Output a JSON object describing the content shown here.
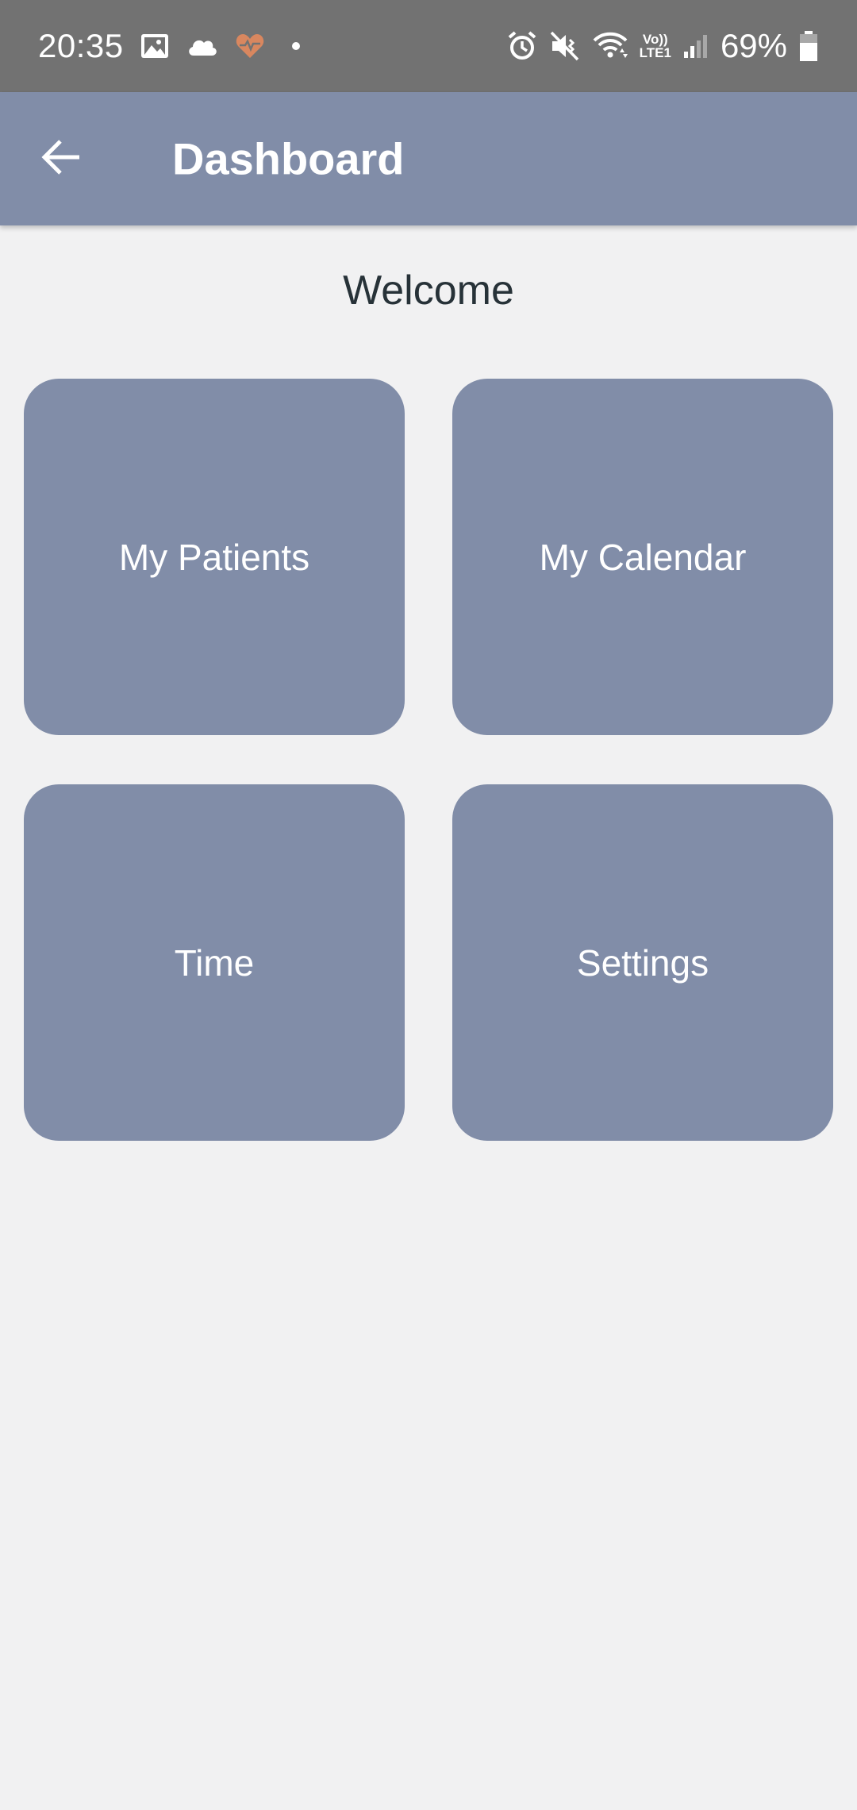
{
  "status_bar": {
    "time": "20:35",
    "battery_percent": "69%",
    "lte_top": "Vo))",
    "lte_bottom": "LTE1",
    "icons": [
      "gallery-icon",
      "cloud-icon",
      "health-heart-icon",
      "notification-dot-icon",
      "alarm-icon",
      "mute-icon",
      "wifi-icon",
      "volte-lte-icon",
      "signal-icon",
      "battery-icon"
    ],
    "colors": {
      "background": "#727272",
      "heart": "#d9875f"
    },
    "battery_level": 0.69
  },
  "app_bar": {
    "title": "Dashboard",
    "back_icon": "arrow-back-icon",
    "color": "#818da8"
  },
  "main": {
    "welcome": "Welcome",
    "tiles": [
      {
        "label": "My Patients"
      },
      {
        "label": "My Calendar"
      },
      {
        "label": "Time"
      },
      {
        "label": "Settings"
      }
    ],
    "tile_color": "#818da8",
    "background": "#f1f1f2"
  }
}
